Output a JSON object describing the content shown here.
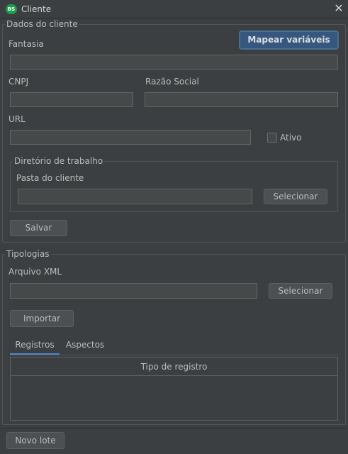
{
  "window": {
    "title": "Cliente",
    "icon": "app-logo-icon",
    "close_glyph": "✕"
  },
  "dados_cliente": {
    "group_title": "Dados do cliente",
    "mapear_button": "Mapear variáveis",
    "fantasia_label": "Fantasia",
    "fantasia_value": "",
    "cnpj_label": "CNPJ",
    "cnpj_value": "",
    "razao_social_label": "Razão Social",
    "razao_social_value": "",
    "url_label": "URL",
    "url_value": "",
    "ativo_label": "Ativo",
    "ativo_checked": false,
    "diretorio": {
      "group_title": "Diretório de trabalho",
      "pasta_label": "Pasta do cliente",
      "pasta_value": "",
      "selecionar_button": "Selecionar"
    },
    "salvar_button": "Salvar"
  },
  "tipologias": {
    "group_title": "Tipologias",
    "arquivo_label": "Arquivo XML",
    "arquivo_value": "",
    "selecionar_button": "Selecionar",
    "importar_button": "Importar",
    "tabs": [
      {
        "label": "Registros",
        "active": true
      },
      {
        "label": "Aspectos",
        "active": false
      }
    ],
    "table": {
      "columns": [
        "Tipo de registro"
      ],
      "rows": []
    }
  },
  "footer": {
    "novo_lote_button": "Novo lote"
  },
  "colors": {
    "background": "#3c3f41",
    "primary_button": "#365880",
    "tab_accent": "#4a88c7"
  }
}
